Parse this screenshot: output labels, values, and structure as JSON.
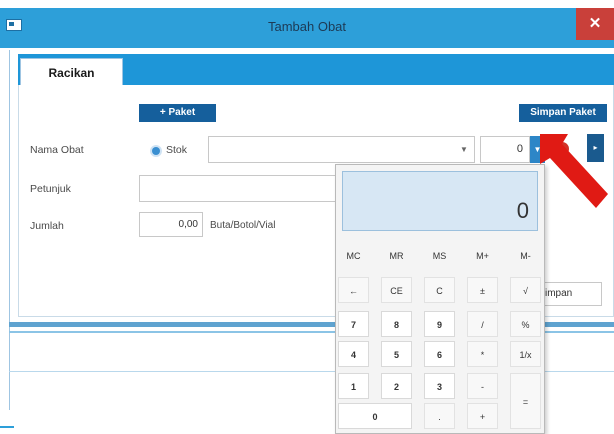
{
  "window": {
    "title": "Tambah Obat",
    "close_label": "✕"
  },
  "tabs": [
    {
      "label": "Racikan"
    }
  ],
  "toolbar": {
    "paket_label": "+ Paket",
    "simpan_paket_label": "Simpan Paket"
  },
  "form": {
    "nama_obat_label": "Nama Obat",
    "stok_radio_label": "Stok",
    "nama_obat_value": "",
    "quantity_value": "0",
    "petunjuk_label": "Petunjuk",
    "petunjuk_value": "",
    "jumlah_label": "Jumlah",
    "jumlah_value": "0,00",
    "unit_label": "Buta/Botol/Vial",
    "simpan_partial": "impan"
  },
  "calculator": {
    "display": "0",
    "rows": [
      [
        "MC",
        "MR",
        "MS",
        "M+",
        "M-"
      ],
      [
        "←",
        "CE",
        "C",
        "±",
        "√"
      ],
      [
        "7",
        "8",
        "9",
        "/",
        "%"
      ],
      [
        "4",
        "5",
        "6",
        "*",
        "1/x"
      ],
      [
        "1",
        "2",
        "3",
        "-",
        "="
      ],
      [
        "0",
        ".",
        "+"
      ]
    ]
  },
  "colors": {
    "accent": "#2d9fd9",
    "tab_strip": "#1e96d8",
    "button_dark": "#155f9c",
    "close": "#c9403a",
    "arrow": "#e01a14"
  }
}
